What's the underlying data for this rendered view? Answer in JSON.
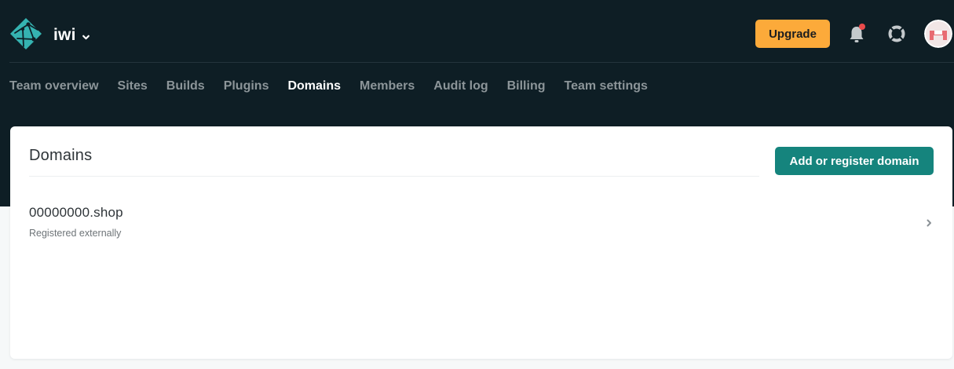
{
  "header": {
    "team_name": "iwi",
    "upgrade_label": "Upgrade",
    "icons": {
      "logo": "netlify-logo-icon",
      "team_menu": "chevron-down-icon",
      "notifications": "bell-icon",
      "help": "lifebuoy-icon",
      "avatar": "user-avatar"
    },
    "colors": {
      "background": "#0e1e25",
      "upgrade_button": "#fcaa3a",
      "notification_dot": "#ea4a4a",
      "logo": "#35b3b1"
    }
  },
  "nav": {
    "items": [
      {
        "label": "Team overview",
        "active": false
      },
      {
        "label": "Sites",
        "active": false
      },
      {
        "label": "Builds",
        "active": false
      },
      {
        "label": "Plugins",
        "active": false
      },
      {
        "label": "Domains",
        "active": true
      },
      {
        "label": "Members",
        "active": false
      },
      {
        "label": "Audit log",
        "active": false
      },
      {
        "label": "Billing",
        "active": false
      },
      {
        "label": "Team settings",
        "active": false
      }
    ]
  },
  "domains_card": {
    "title": "Domains",
    "add_button_label": "Add or register domain",
    "add_button_color": "#15847d",
    "domains": [
      {
        "name": "00000000.shop",
        "status": "Registered externally"
      }
    ]
  }
}
